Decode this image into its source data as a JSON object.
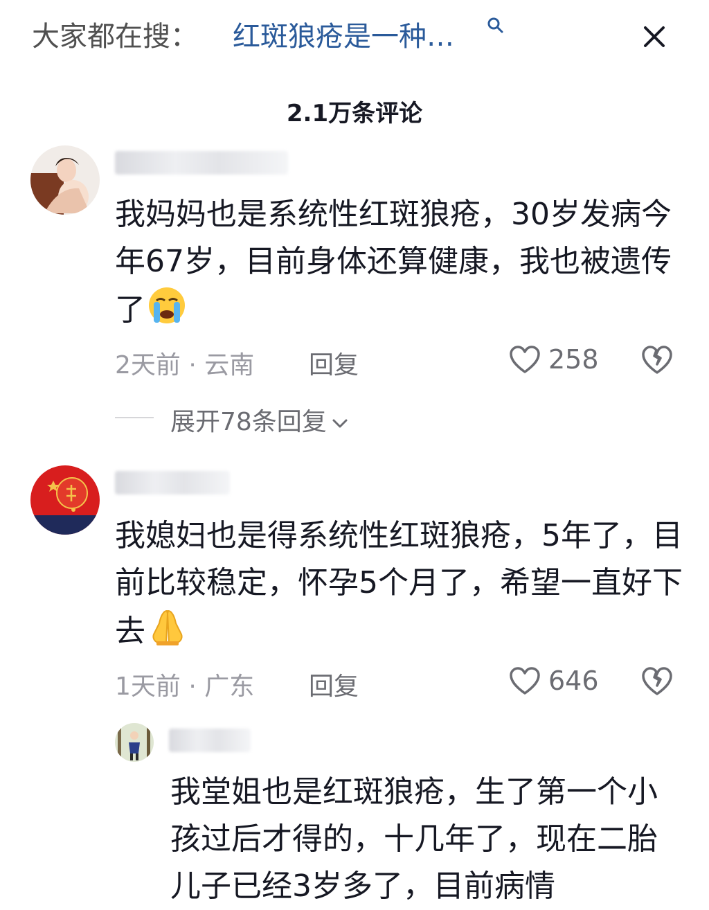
{
  "search": {
    "prefix": "大家都在搜：",
    "query": "红斑狼疮是一种…",
    "icon": "search-icon",
    "close_icon": "close-icon",
    "query_color": "#2a5a9a"
  },
  "comment_count": "2.1万条评论",
  "comments": [
    {
      "text": "我妈妈也是系统性红斑狼疮，30岁发病今年67岁，目前身体还算健康，我也被遗传了",
      "emoji": "crying-face-emoji",
      "time": "2天前",
      "location": "云南",
      "separator": " · ",
      "reply_label": "回复",
      "likes": "258",
      "expand_label": "展开78条回复"
    },
    {
      "text": "我媳妇也是得系统性红斑狼疮，5年了，目前比较稳定，怀孕5个月了，希望一直好下去",
      "emoji": "folded-hands-emoji",
      "time": "1天前",
      "location": "广东",
      "separator": " · ",
      "reply_label": "回复",
      "likes": "646"
    }
  ],
  "reply": {
    "text": "我堂姐也是红斑狼疮，生了第一个小孩过后才得的，十几年了，现在二胎儿子已经3岁多了，目前病情"
  }
}
